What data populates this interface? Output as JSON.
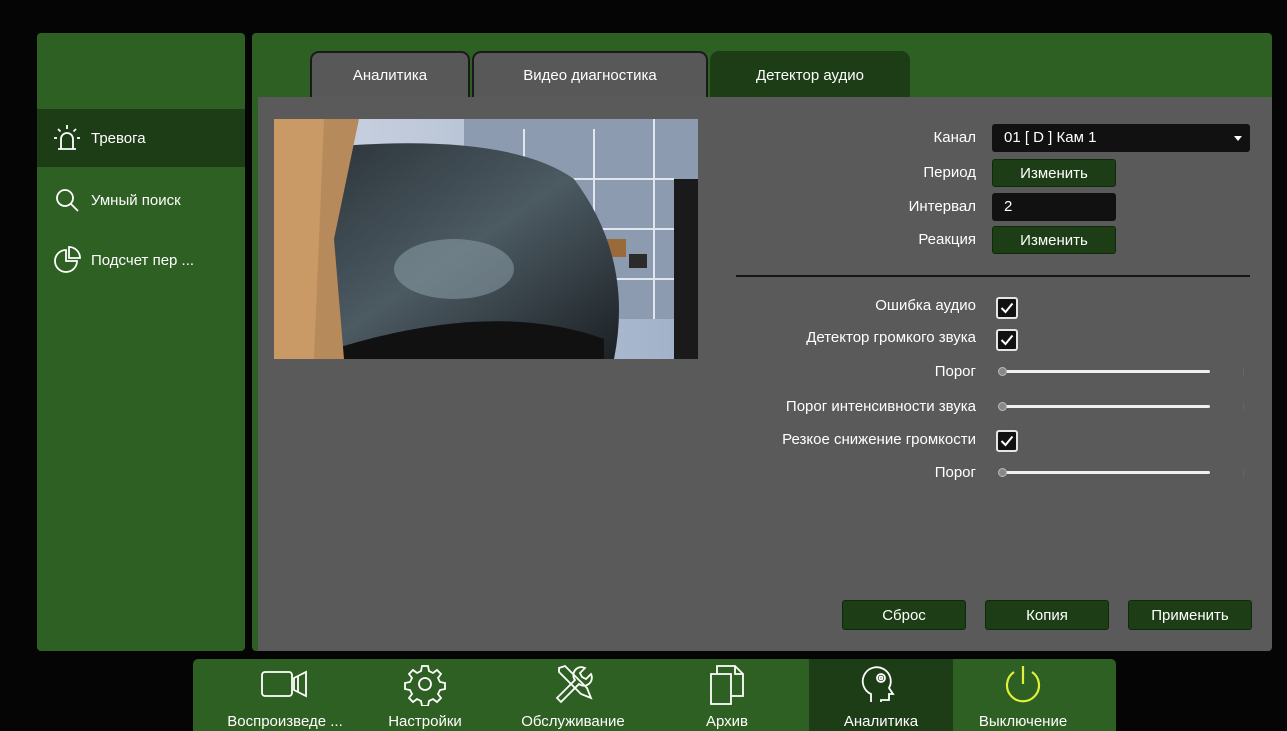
{
  "sidebar": {
    "items": [
      {
        "label": "Тревога",
        "icon": "alarm-light-icon",
        "active": true
      },
      {
        "label": "Умный поиск",
        "icon": "search-icon",
        "active": false
      },
      {
        "label": "Подсчет пер ...",
        "icon": "pie-chart-icon",
        "active": false
      }
    ]
  },
  "tabs": [
    {
      "label": "Аналитика",
      "active": false
    },
    {
      "label": "Видео диагностика",
      "active": false
    },
    {
      "label": "Детектор аудио",
      "active": true
    }
  ],
  "form": {
    "channel_label": "Канал",
    "channel_value": "01 [ D ] Кам 1",
    "period_label": "Период",
    "period_button": "Изменить",
    "interval_label": "Интервал",
    "interval_value": "2",
    "reaction_label": "Реакция",
    "reaction_button": "Изменить",
    "audio_error_label": "Ошибка аудио",
    "audio_error_checked": true,
    "loud_detector_label": "Детектор громкого звука",
    "loud_detector_checked": true,
    "threshold1_label": "Порог",
    "intensity_threshold_label": "Порог интенсивности звука",
    "sharp_drop_label": "Резкое снижение громкости",
    "sharp_drop_checked": true,
    "threshold2_label": "Порог"
  },
  "buttons": {
    "reset": "Сброс",
    "copy": "Копия",
    "apply": "Применить"
  },
  "bottombar": {
    "items": [
      {
        "label": "Воспроизведе ...",
        "icon": "video-camera-icon",
        "active": false
      },
      {
        "label": "Настройки",
        "icon": "gear-icon",
        "active": false
      },
      {
        "label": "Обслуживание",
        "icon": "tools-icon",
        "active": false
      },
      {
        "label": "Архив",
        "icon": "files-icon",
        "active": false
      },
      {
        "label": "Аналитика",
        "icon": "head-brain-icon",
        "active": true
      },
      {
        "label": "Выключение",
        "icon": "power-icon",
        "active": false
      }
    ]
  },
  "colors": {
    "panel_green": "#2d6022",
    "dark_green": "#1d3d16",
    "content_gray": "#5a5a5a",
    "power_yellow": "#e3ef3a"
  }
}
